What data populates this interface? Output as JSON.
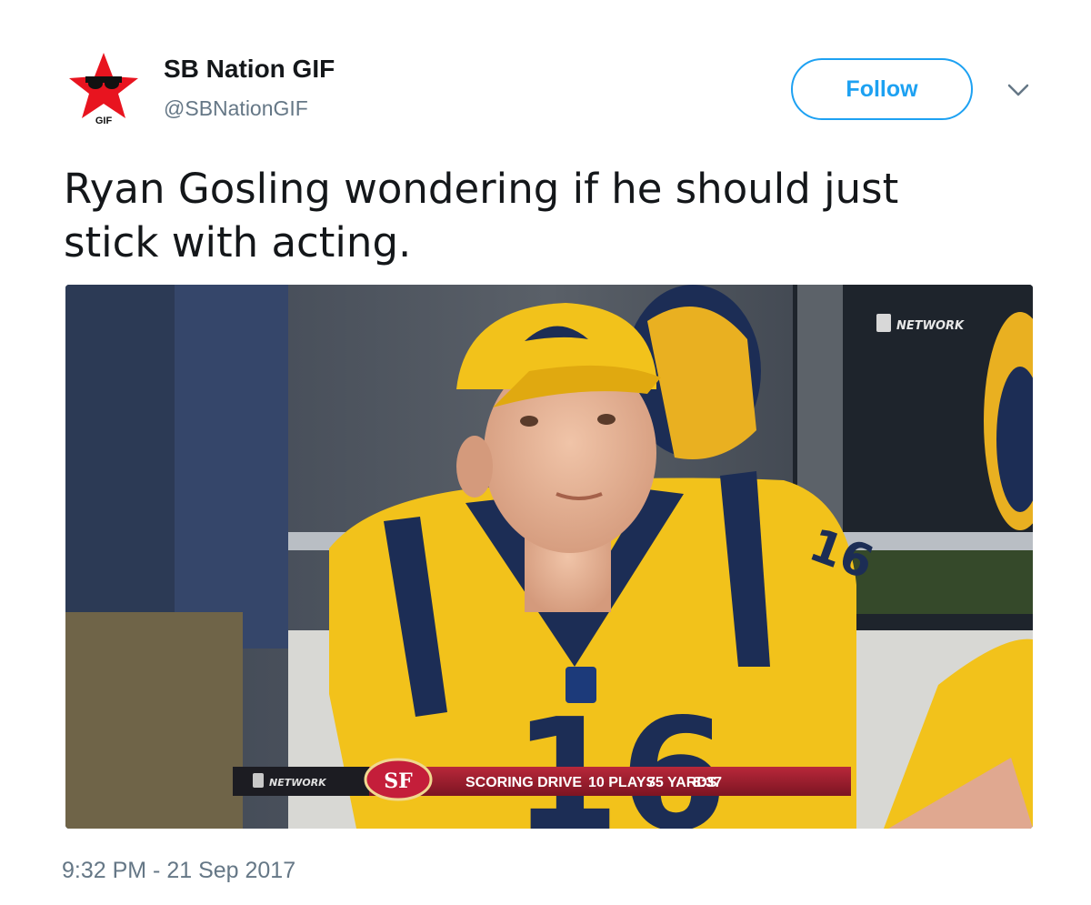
{
  "author": {
    "name": "SB Nation GIF",
    "handle": "@SBNationGIF",
    "avatar_icon": "red-star-gif-logo",
    "avatar_label": "GIF"
  },
  "follow_button": {
    "label": "Follow"
  },
  "menu_icon": "chevron-down-icon",
  "tweet": {
    "text": "Ryan Gosling wondering if he should just stick with acting.",
    "timestamp": "9:32 PM - 21 Sep 2017"
  },
  "media": {
    "network_bug": "NETWORK",
    "scorebar": {
      "network": "NETWORK",
      "team_logo": "SF",
      "label": "SCORING DRIVE",
      "plays": "10 PLAYS",
      "yards": "75 YARDS",
      "time": "8:37"
    },
    "jersey_number": "16"
  },
  "colors": {
    "accent": "#1da1f2",
    "text": "#14171a",
    "secondary_text": "#657786",
    "avatar_star": "#e8141f",
    "jersey_yellow": "#f2c21b",
    "jersey_navy": "#1c2d55",
    "scorebar_red": "#9b1a2a"
  }
}
